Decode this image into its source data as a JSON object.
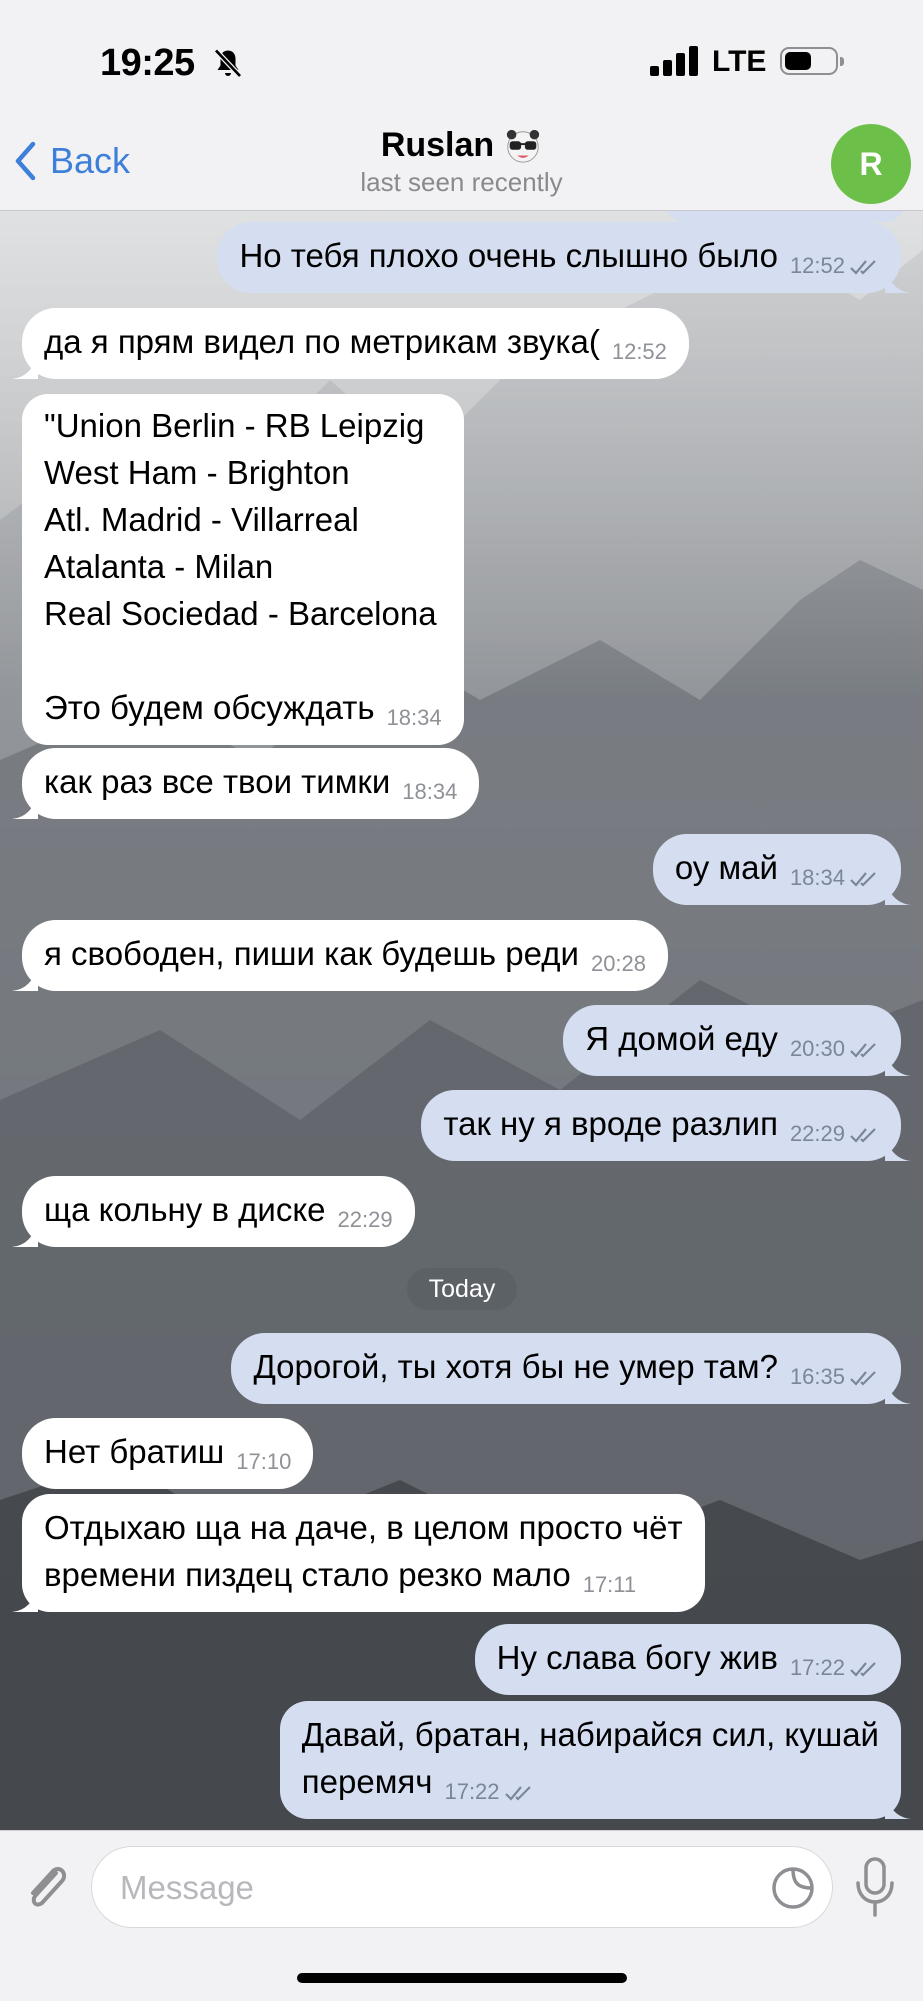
{
  "status_bar": {
    "time": "19:25",
    "network": "LTE",
    "icons": [
      "bell-slash-icon",
      "signal-icon",
      "battery-icon"
    ]
  },
  "header": {
    "back_label": "Back",
    "contact_name": "Ruslan",
    "status": "last seen recently",
    "avatar_initial": "R",
    "avatar_color": "#6cc04a"
  },
  "messages": [
    {
      "dir": "out",
      "text": "Но тебя плохо очень слышно было",
      "time": "12:52"
    },
    {
      "dir": "in",
      "text": "да я прям видел по метрикам звука(",
      "time": "12:52"
    },
    {
      "dir": "in",
      "text": "\"Union Berlin - RB Leipzig\nWest Ham - Brighton\nAtl. Madrid - Villarreal\nAtalanta - Milan\nReal Sociedad - Barcelona\n\nЭто будем обсуждать",
      "time": "18:34"
    },
    {
      "dir": "in",
      "text": "как раз все твои тимки",
      "time": "18:34"
    },
    {
      "dir": "out",
      "text": "оу май",
      "time": "18:34"
    },
    {
      "dir": "in",
      "text": "я свободен, пиши как будешь реди",
      "time": "20:28"
    },
    {
      "dir": "out",
      "text": "Я домой еду",
      "time": "20:30"
    },
    {
      "dir": "out",
      "text": "так ну я вроде разлип",
      "time": "22:29"
    },
    {
      "dir": "in",
      "text": "ща кольну в диске",
      "time": "22:29"
    },
    {
      "dir": "out",
      "text": "Дорогой, ты хотя бы не умер там?",
      "time": "16:35"
    },
    {
      "dir": "in",
      "text": "Нет братиш",
      "time": "17:10"
    },
    {
      "dir": "in",
      "text": "Отдыхаю ща на даче, в целом просто чёт\nвремени пиздец стало резко мало",
      "time": "17:11"
    },
    {
      "dir": "out",
      "text": "Ну слава богу жив",
      "time": "17:22"
    },
    {
      "dir": "out",
      "text": "Давай, братан, набирайся сил, кушай\nперемяч",
      "time": "17:22"
    }
  ],
  "date_divider": "Today",
  "composer": {
    "placeholder": "Message",
    "value": ""
  },
  "colors": {
    "accent": "#3d7fd9",
    "incoming_bubble": "#ffffff",
    "outgoing_bubble": "#d4def0"
  }
}
